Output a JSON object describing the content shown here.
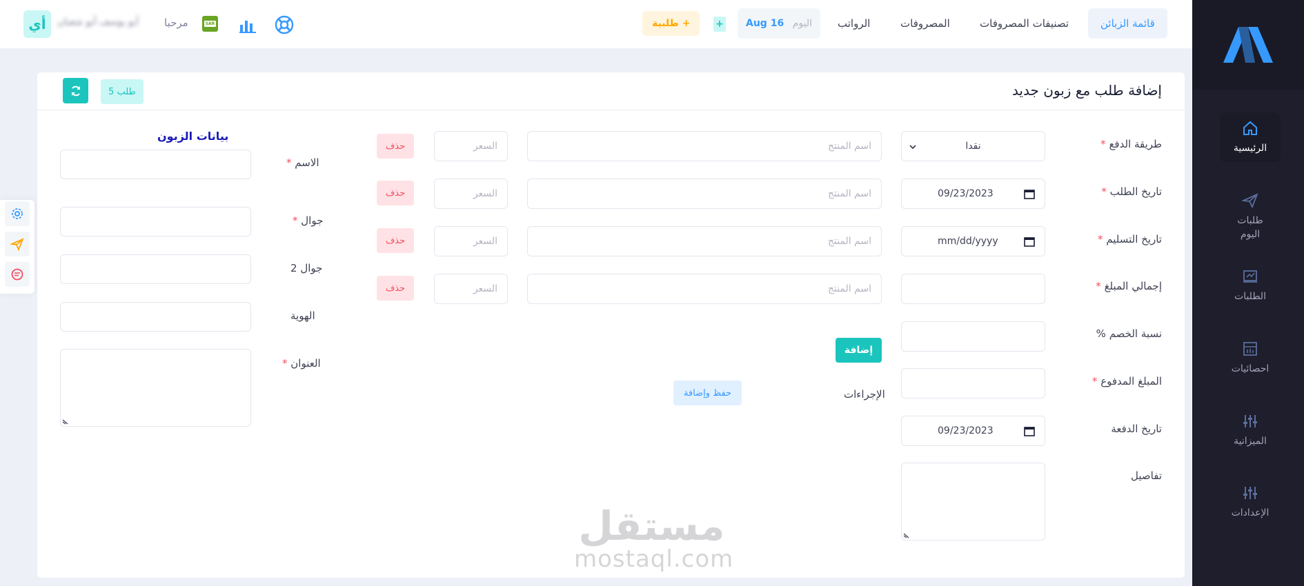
{
  "sidebar": {
    "items": [
      {
        "label": "الرئيسية",
        "icon": "home-icon"
      },
      {
        "label": "طلبات اليوم",
        "icon": "paper-plane-icon"
      },
      {
        "label": "الطلبات",
        "icon": "chart-screen-icon"
      },
      {
        "label": "احصائيات",
        "icon": "stats-icon"
      },
      {
        "label": "الميزانية",
        "icon": "sliders-icon"
      },
      {
        "label": "الإعدادات",
        "icon": "sliders-icon"
      }
    ]
  },
  "header": {
    "nav": [
      "قائمة الزبائن",
      "تصنيفات المصروفات",
      "المصروفات",
      "الرواتب"
    ],
    "today_label": "اليوم",
    "today_date": "Aug 16",
    "new_order": "طلبية +",
    "plus": "+",
    "welcome": "مرحبا",
    "user_name": "أبو يوسف أبو شعبان",
    "avatar_text": "أي",
    "badge_text": "SAR"
  },
  "card": {
    "title": "إضافة طلب مع زبون جديد",
    "order_count": "5 طلب"
  },
  "form": {
    "payment_method": {
      "label": "طريقة الدفع",
      "value": "نقدا"
    },
    "order_date": {
      "label": "تاريخ الطلب",
      "value": "09/23/2023"
    },
    "delivery_date": {
      "label": "تاريخ التسليم",
      "value": "mm/dd/yyyy"
    },
    "total_amount": {
      "label": "إجمالي المبلغ"
    },
    "discount": {
      "label": "نسبة الخصم %"
    },
    "paid_amount": {
      "label": "المبلغ المدفوع"
    },
    "payment_date": {
      "label": "تاريخ الدفعة",
      "value": "09/23/2023"
    },
    "details": {
      "label": "تفاصيل"
    },
    "required_mark": "*"
  },
  "products": {
    "name_placeholder": "اسم المنتج",
    "price_placeholder": "السعر",
    "delete_label": "حذف",
    "add_label": "إضافة",
    "actions_label": "الإجراءات",
    "save_add_label": "حفظ وإضافة"
  },
  "customer": {
    "title": "بيانات الزبون",
    "name": "الاسم",
    "mobile": "جوال",
    "mobile2": "جوال 2",
    "id": "الهوية",
    "address": "العنوان"
  },
  "watermark": {
    "ar": "مستقل",
    "en": "mostaql.com"
  },
  "colors": {
    "accent": "#1bc5bd",
    "primary": "#3699ff",
    "danger": "#f64e60",
    "sidebar": "#1e1e2d"
  }
}
